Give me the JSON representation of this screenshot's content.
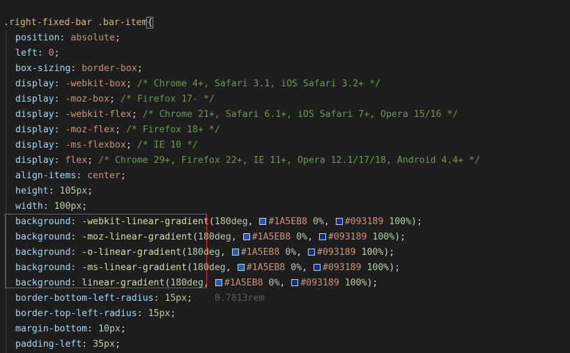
{
  "selector": ".right-fixed-bar .bar-item",
  "brace_open": "{",
  "colors": {
    "start": "#1A5EB8",
    "end": "#093189",
    "highlight_box": "#e0323a"
  },
  "lines": [
    {
      "p": "position",
      "v": "absolute",
      "c": ""
    },
    {
      "p": "left",
      "v": "0",
      "c": ""
    },
    {
      "p": "box-sizing",
      "v": "border-box",
      "c": ""
    },
    {
      "p": "display",
      "v": "-webkit-box",
      "c": "/* Chrome 4+, Safari 3.1, iOS Safari 3.2+ */"
    },
    {
      "p": "display",
      "v": "-moz-box",
      "c": "/* Firefox 17- */"
    },
    {
      "p": "display",
      "v": "-webkit-flex",
      "c": "/* Chrome 21+, Safari 6.1+, iOS Safari 7+, Opera 15/16 */"
    },
    {
      "p": "display",
      "v": "-moz-flex",
      "c": "/* Firefox 18+ */"
    },
    {
      "p": "display",
      "v": "-ms-flexbox",
      "c": "/* IE 10 */"
    },
    {
      "p": "display",
      "v": "flex",
      "c": "/* Chrome 29+, Firefox 22+, IE 11+, Opera 12.1/17/18, Android 4.4+ */"
    },
    {
      "p": "align-items",
      "v": "center",
      "c": ""
    },
    {
      "p": "height",
      "n": "105px"
    },
    {
      "p": "width",
      "n": "100px"
    },
    {
      "p": "background",
      "fn": "-webkit-linear-gradient",
      "deg": "180deg",
      "c1": "#1A5EB8",
      "s1": "0%",
      "c2": "#093189",
      "s2": "100%"
    },
    {
      "p": "background",
      "fn": "-moz-linear-gradient",
      "deg": "180deg",
      "c1": "#1A5EB8",
      "s1": "0%",
      "c2": "#093189",
      "s2": "100%"
    },
    {
      "p": "background",
      "fn": "-o-linear-gradient",
      "deg": "180deg",
      "c1": "#1A5EB8",
      "s1": "0%",
      "c2": "#093189",
      "s2": "100%"
    },
    {
      "p": "background",
      "fn": "-ms-linear-gradient",
      "deg": "180deg",
      "c1": "#1A5EB8",
      "s1": "0%",
      "c2": "#093189",
      "s2": "100%"
    },
    {
      "p": "background",
      "fn": "linear-gradient",
      "deg": "180deg",
      "c1": "#1A5EB8",
      "s1": "0%",
      "c2": "#093189",
      "s2": "100%"
    },
    {
      "p": "border-bottom-left-radius",
      "n": "15px",
      "hint": "0.7813rem"
    },
    {
      "p": "border-top-left-radius",
      "n": "15px"
    },
    {
      "p": "margin-bottom",
      "n": "10px"
    },
    {
      "p": "padding-left",
      "n": "35px"
    }
  ]
}
